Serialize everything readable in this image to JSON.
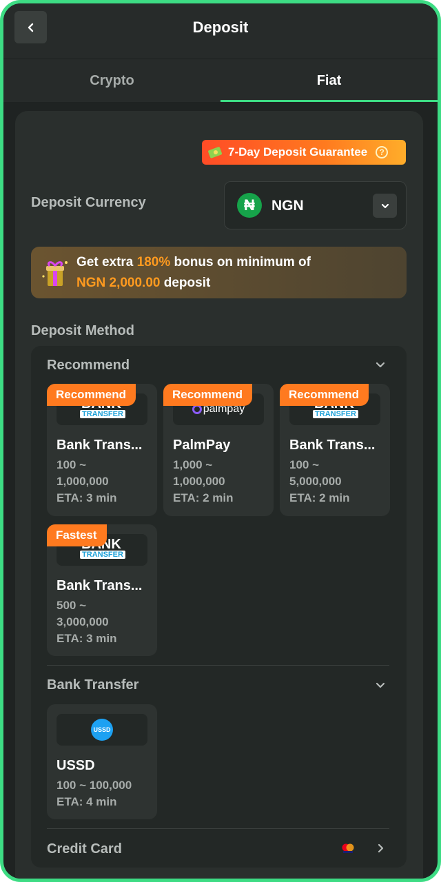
{
  "header": {
    "title": "Deposit"
  },
  "tabs": [
    {
      "label": "Crypto",
      "active": false
    },
    {
      "label": "Fiat",
      "active": true
    }
  ],
  "guarantee": {
    "label": "7-Day Deposit Guarantee"
  },
  "currency": {
    "label": "Deposit Currency",
    "symbol": "₦",
    "code": "NGN"
  },
  "bonus": {
    "prefix": "Get extra ",
    "percent": "180%",
    "middle": " bonus on minimum of",
    "amount": "NGN 2,000.00",
    "suffix": " deposit"
  },
  "deposit_method": {
    "label": "Deposit Method"
  },
  "sections": {
    "recommend": {
      "title": "Recommend",
      "cards": [
        {
          "tag": "Recommend",
          "logo": "bank-transfer-logo",
          "name": "Bank Trans...",
          "range_line1": "100 ~",
          "range_line2": "1,000,000",
          "eta": "ETA: 3 min"
        },
        {
          "tag": "Recommend",
          "logo": "palmpay-logo",
          "logo_text": "palmpay",
          "name": "PalmPay",
          "range_line1": "1,000 ~",
          "range_line2": "1,000,000",
          "eta": "ETA: 2 min"
        },
        {
          "tag": "Recommend",
          "logo": "bank-transfer-logo",
          "name": "Bank Trans...",
          "range_line1": "100 ~",
          "range_line2": "5,000,000",
          "eta": "ETA: 2 min"
        },
        {
          "tag": "Fastest",
          "logo": "bank-transfer-logo",
          "name": "Bank Trans...",
          "range_line1": "500 ~",
          "range_line2": "3,000,000",
          "eta": "ETA: 3 min"
        }
      ]
    },
    "bank_transfer": {
      "title": "Bank Transfer",
      "cards": [
        {
          "logo": "ussd-logo",
          "logo_text": "USSD",
          "name": "USSD",
          "range": "100 ~ 100,000",
          "eta": "ETA: 4 min"
        }
      ]
    },
    "credit_card": {
      "title": "Credit Card"
    }
  },
  "bank_logo": {
    "top": "BANK",
    "bottom": "TRANSFER"
  },
  "colors": {
    "accent": "#3ddc84",
    "tag": "#ff7a1f",
    "highlight": "#ff9a1f"
  }
}
